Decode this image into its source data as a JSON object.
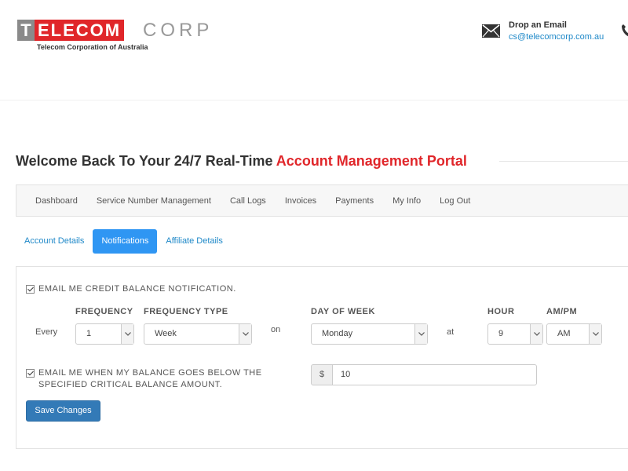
{
  "header": {
    "logo": {
      "t": "T",
      "ele": "ELECOM",
      "corp": "CORP",
      "subtitle": "Telecom Corporation of Australia"
    },
    "contact": {
      "title": "Drop an Email",
      "email": "cs@telecomcorp.com.au",
      "mail_icon": "envelope-icon",
      "phone_icon": "phone-icon"
    }
  },
  "title": {
    "prefix": "Welcome Back To Your 24/7 Real-Time ",
    "accent": "Account Management Portal"
  },
  "nav": {
    "items": [
      "Dashboard",
      "Service Number Management",
      "Call Logs",
      "Invoices",
      "Payments",
      "My Info",
      "Log Out"
    ]
  },
  "tabs": [
    {
      "label": "Account Details",
      "active": false
    },
    {
      "label": "Notifications",
      "active": true
    },
    {
      "label": "Affiliate Details",
      "active": false
    }
  ],
  "notifications": {
    "credit_balance_label": "EMAIL ME CREDIT BALANCE NOTIFICATION.",
    "credit_balance_checked": true,
    "every_label": "Every",
    "frequency_label": "FREQUENCY",
    "frequency_value": "1",
    "frequency_type_label": "FREQUENCY TYPE",
    "frequency_type_value": "Week",
    "on_label": "on",
    "day_of_week_label": "DAY OF WEEK",
    "day_of_week_value": "Monday",
    "at_label": "at",
    "hour_label": "HOUR",
    "hour_value": "9",
    "ampm_label": "AM/PM",
    "ampm_value": "AM",
    "critical_balance_line1": "EMAIL ME WHEN MY BALANCE GOES BELOW THE",
    "critical_balance_line2": "SPECIFIED CRITICAL BALANCE AMOUNT.",
    "critical_balance_checked": true,
    "currency_symbol": "$",
    "critical_amount": "10",
    "save_label": "Save Changes"
  },
  "colors": {
    "accent_red": "#e0262a",
    "link_blue": "#1e88c8",
    "tab_active": "#2f96f3",
    "button_blue": "#337ab7"
  }
}
